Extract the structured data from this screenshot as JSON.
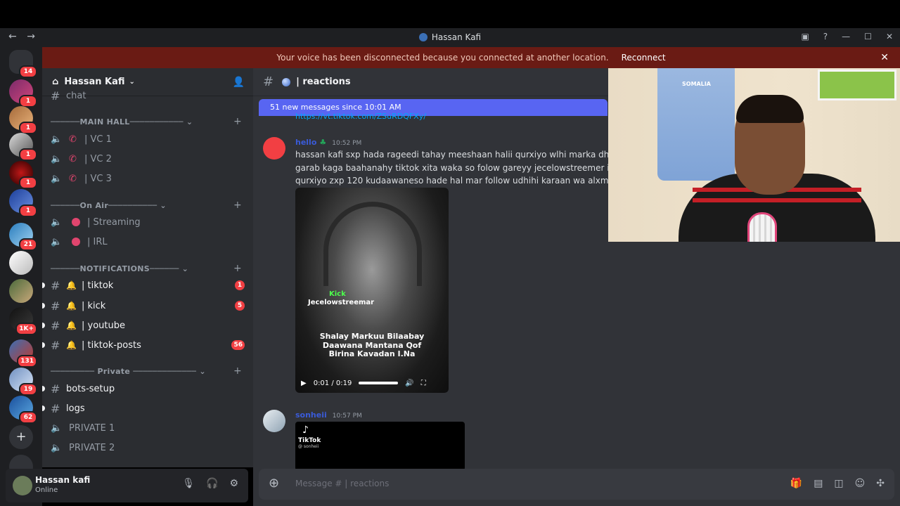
{
  "window": {
    "title": "Hassan Kafi",
    "back": "←",
    "forward": "→"
  },
  "banner": {
    "message": "Your voice has been disconnected because you connected at another location.",
    "action": "Reconnect",
    "close": "✕"
  },
  "guild_badges": [
    "14",
    "1",
    "1",
    "1",
    "1",
    "1",
    "21",
    "1K+",
    "131",
    "19",
    "62"
  ],
  "server": {
    "name": "Hassan Kafi",
    "partial_channel": "chat"
  },
  "categories": {
    "main_hall": "MAIN HALL",
    "on_air": "On Air",
    "notifications": "NOTIFICATIONS",
    "private": "Private"
  },
  "channels": {
    "vc1": "| VC 1",
    "vc2": "| VC 2",
    "vc3": "| VC 3",
    "streaming": "| Streaming",
    "irl": "| IRL",
    "tiktok": "| tiktok",
    "tiktok_badge": "1",
    "kick": "| kick",
    "kick_badge": "5",
    "youtube": "| youtube",
    "tiktok_posts": "| tiktok-posts",
    "tiktok_posts_badge": "56",
    "bots_setup": "bots-setup",
    "logs": "logs",
    "private1": "PRIVATE 1",
    "private2": "PRIVATE 2"
  },
  "user": {
    "name": "Hassan kafi",
    "status": "Online"
  },
  "channel_header": {
    "name": "| reactions"
  },
  "new_messages": "51 new messages since 10:01 AM",
  "link_text": "https://vt.tiktok.com/ZSuRDQFXy/",
  "message1": {
    "author": "hello",
    "time": "10:52 PM",
    "text": "hassan kafi sxp hada rageedi tahay meeshaan halii qurxiyo wlhi marka dhalinyar garab kaga baahanahy tiktok xita waka so folow gareyy jecelowstreemer igu qor qurxiyo zxp 120 kudaawaneso hade hal mar follow udhihi karaan wa alxm"
  },
  "video": {
    "kick": "Kick",
    "kick_name": "Jecelowstreemar",
    "caption_l1": "Shalay Markuu Bilaabay",
    "caption_l2": "Daawana Mantana Qof",
    "caption_l3": "Birina Kavadan I.Na",
    "time": "0:01 / 0:19"
  },
  "message2": {
    "author": "sonheii",
    "time": "10:57 PM",
    "tiktok": "TikTok",
    "tiktok_user": "@ sonheii"
  },
  "composer": {
    "placeholder": "Message # | reactions"
  },
  "webcam": {
    "shirt_text": "SOMALIA"
  },
  "colors": {
    "accent": "#5865f2",
    "danger": "#f23f43",
    "banner": "#6a1b14"
  }
}
